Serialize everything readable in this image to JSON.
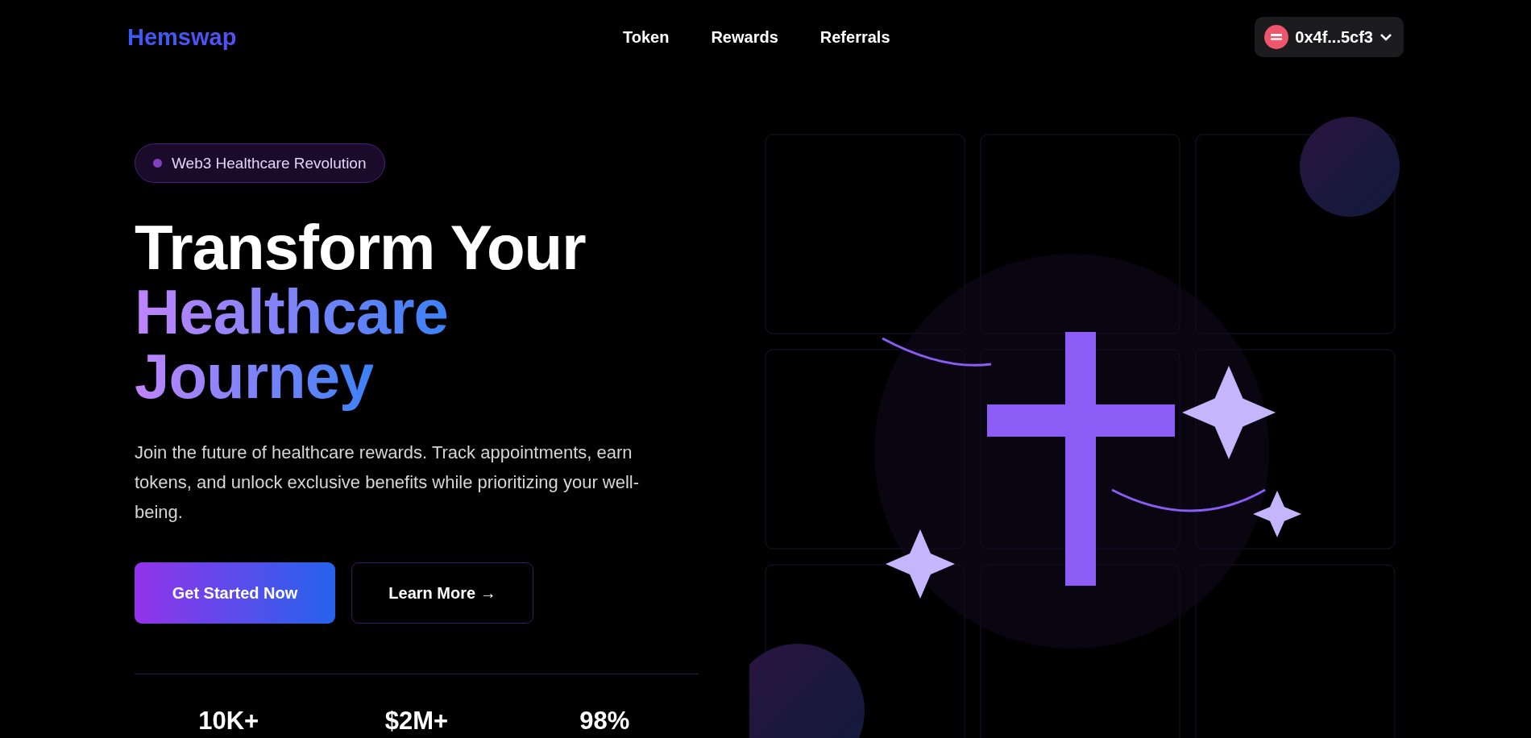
{
  "header": {
    "brand": "Hemswap",
    "nav": [
      {
        "label": "Token"
      },
      {
        "label": "Rewards"
      },
      {
        "label": "Referrals"
      }
    ],
    "wallet": {
      "address": "0x4f...5cf3"
    }
  },
  "hero": {
    "badge": "Web3 Healthcare Revolution",
    "headline": "Transform Your",
    "headline_highlight": [
      "Healthcare",
      "Journey"
    ],
    "description": "Join the future of healthcare rewards. Track appointments, earn tokens, and unlock exclusive benefits while prioritizing your well-being.",
    "buttons": [
      {
        "label": "Get Started Now",
        "kind": "primary"
      },
      {
        "label": "Learn More →",
        "kind": "secondary"
      }
    ],
    "stats": [
      {
        "value": "10K+"
      },
      {
        "value": "$2M+"
      },
      {
        "value": "98%"
      }
    ]
  }
}
